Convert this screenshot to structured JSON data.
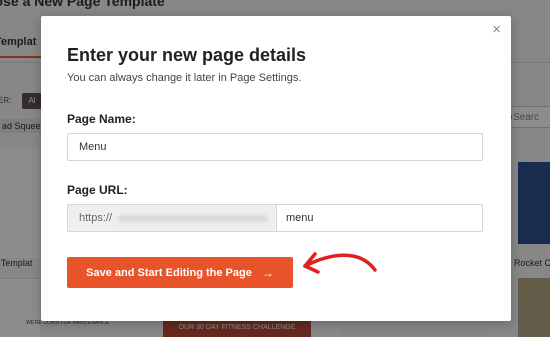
{
  "background": {
    "page_title": "oose a New Page Template",
    "tab_label": "Templat",
    "filter_label": "ER:",
    "filter_all": "Al",
    "chip_label": "ad Squeez",
    "search_placeholder": "Searc",
    "left_card_label": "k Templat",
    "right_card_label": "Rocket C",
    "left_thumb_text": "WE'RE DOWN FOR MAINTENANCE",
    "mid_thumb_text": "OUR 30 DAY FITNESS CHALLENGE"
  },
  "modal": {
    "close_glyph": "×",
    "title": "Enter your new page details",
    "subtitle": "You can always change it later in Page Settings.",
    "page_name": {
      "label": "Page Name:",
      "value": "Menu"
    },
    "page_url": {
      "label": "Page URL:",
      "prefix": "https://",
      "slug": "menu"
    },
    "submit_button": {
      "label": "Save and Start Editing the Page",
      "arrow": "→"
    }
  },
  "colors": {
    "accent": "#e9532a",
    "annotation_arrow": "#e0201f",
    "overlay": "rgba(0,0,0,0.45)"
  }
}
